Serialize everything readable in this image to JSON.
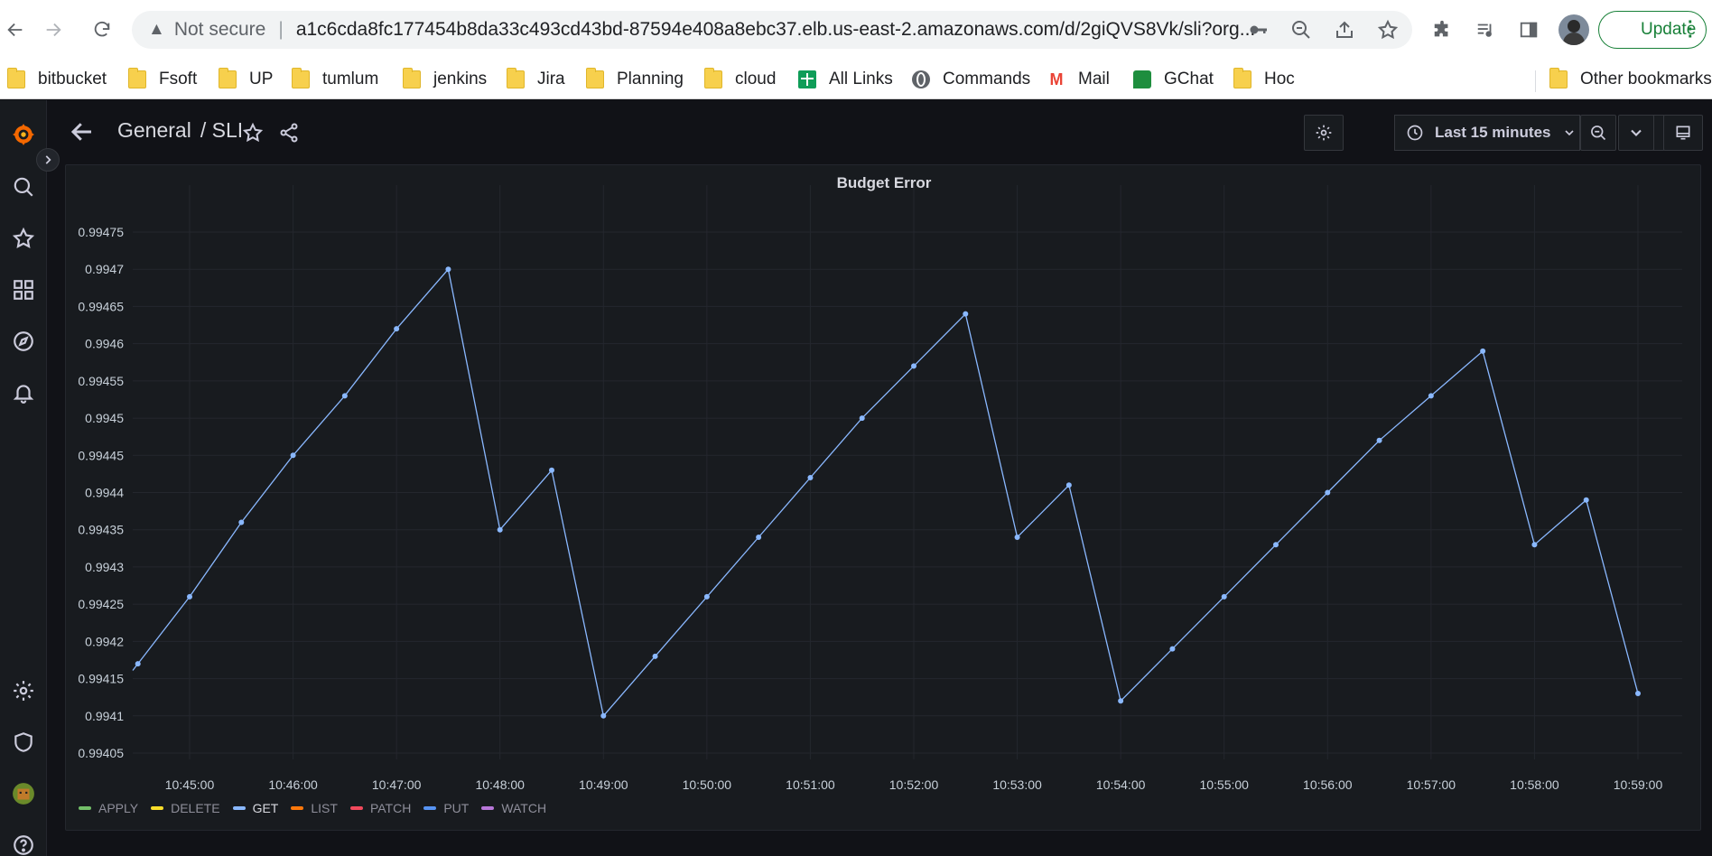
{
  "browser": {
    "security_warning": "Not secure",
    "url": "a1c6cda8fc177454b8da33c493cd43bd-87594e408a8ebc37.elb.us-east-2.amazonaws.com/d/2giQVS8Vk/sli?org...",
    "update_label": "Update",
    "bookmarks": [
      {
        "label": "bitbucket",
        "icon": "folder-icon"
      },
      {
        "label": "Fsoft",
        "icon": "folder-icon"
      },
      {
        "label": "UP",
        "icon": "folder-icon"
      },
      {
        "label": "tumlum",
        "icon": "folder-icon"
      },
      {
        "label": "jenkins",
        "icon": "folder-icon"
      },
      {
        "label": "Jira",
        "icon": "folder-icon"
      },
      {
        "label": "Planning",
        "icon": "folder-icon"
      },
      {
        "label": "cloud",
        "icon": "folder-icon"
      },
      {
        "label": "All Links",
        "icon": "sheets-icon"
      },
      {
        "label": "Commands",
        "icon": "globe-icon"
      },
      {
        "label": "Mail",
        "icon": "gmail-icon"
      },
      {
        "label": "GChat",
        "icon": "chat-icon"
      },
      {
        "label": "Hoc",
        "icon": "folder-icon"
      }
    ],
    "other_bookmarks": "Other bookmarks"
  },
  "dashboard": {
    "folder": "General",
    "title": "/ SLI",
    "time_range": "Last 15 minutes",
    "colors": {
      "accent": "#f46800",
      "series": "#8ab8ff",
      "background": "#111217",
      "panel": "#181b1f"
    }
  },
  "panel": {
    "title": "Budget Error"
  },
  "chart_data": {
    "type": "line",
    "title": "Budget Error",
    "xlabel": "",
    "ylabel": "",
    "grid": true,
    "legend_placement": "bottom-left",
    "ylim": [
      0.994,
      0.9948
    ],
    "y_ticks": [
      "0.99405",
      "0.9941",
      "0.99415",
      "0.9942",
      "0.99425",
      "0.9943",
      "0.99435",
      "0.9944",
      "0.99445",
      "0.9945",
      "0.99455",
      "0.9946",
      "0.99465",
      "0.9947",
      "0.99475"
    ],
    "x_ticks": [
      "10:45:00",
      "10:46:00",
      "10:47:00",
      "10:48:00",
      "10:49:00",
      "10:50:00",
      "10:51:00",
      "10:52:00",
      "10:53:00",
      "10:54:00",
      "10:55:00",
      "10:56:00",
      "10:57:00",
      "10:58:00",
      "10:59:00"
    ],
    "series": [
      {
        "name": "GET",
        "color": "#8ab8ff",
        "points": [
          [
            "10:44:30",
            0.99417
          ],
          [
            "10:45:00",
            0.99426
          ],
          [
            "10:45:30",
            0.99436
          ],
          [
            "10:46:00",
            0.99445
          ],
          [
            "10:46:30",
            0.99453
          ],
          [
            "10:47:00",
            0.99462
          ],
          [
            "10:47:30",
            0.9947
          ],
          [
            "10:48:00",
            0.99435
          ],
          [
            "10:48:30",
            0.99443
          ],
          [
            "10:49:00",
            0.9941
          ],
          [
            "10:49:30",
            0.99418
          ],
          [
            "10:50:00",
            0.99426
          ],
          [
            "10:50:30",
            0.99434
          ],
          [
            "10:51:00",
            0.99442
          ],
          [
            "10:51:30",
            0.9945
          ],
          [
            "10:52:00",
            0.99457
          ],
          [
            "10:52:30",
            0.99464
          ],
          [
            "10:53:00",
            0.99434
          ],
          [
            "10:53:30",
            0.99441
          ],
          [
            "10:54:00",
            0.99412
          ],
          [
            "10:54:30",
            0.99419
          ],
          [
            "10:55:00",
            0.99426
          ],
          [
            "10:55:30",
            0.99433
          ],
          [
            "10:56:00",
            0.9944
          ],
          [
            "10:56:30",
            0.99447
          ],
          [
            "10:57:00",
            0.99453
          ],
          [
            "10:57:30",
            0.99459
          ],
          [
            "10:58:00",
            0.99433
          ],
          [
            "10:58:30",
            0.99439
          ],
          [
            "10:59:00",
            0.99413
          ]
        ]
      }
    ],
    "legend": [
      {
        "name": "APPLY",
        "color": "#73bf69",
        "active": false
      },
      {
        "name": "DELETE",
        "color": "#fade2a",
        "active": false
      },
      {
        "name": "GET",
        "color": "#8ab8ff",
        "active": true
      },
      {
        "name": "LIST",
        "color": "#ff780a",
        "active": false
      },
      {
        "name": "PATCH",
        "color": "#f2495c",
        "active": false
      },
      {
        "name": "PUT",
        "color": "#5794f2",
        "active": false
      },
      {
        "name": "WATCH",
        "color": "#b877d9",
        "active": false
      }
    ]
  }
}
